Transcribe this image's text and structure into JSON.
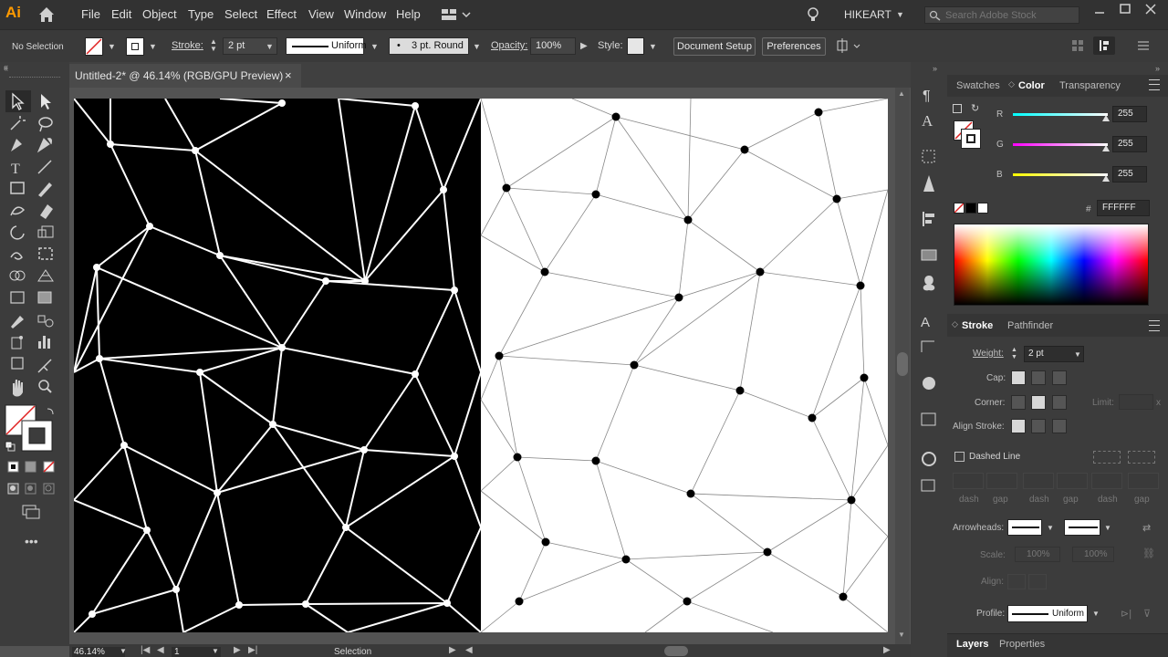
{
  "app": {
    "logo": "Ai"
  },
  "menu": {
    "items": [
      "File",
      "Edit",
      "Object",
      "Type",
      "Select",
      "Effect",
      "View",
      "Window",
      "Help"
    ],
    "user": "HIKEART",
    "search_placeholder": "Search Adobe Stock"
  },
  "control_bar": {
    "selection": "No Selection",
    "stroke_label": "Stroke:",
    "stroke_value": "2 pt",
    "profile": "Uniform",
    "brush": "3 pt. Round",
    "opacity_label": "Opacity:",
    "opacity_value": "100%",
    "style_label": "Style:",
    "document_setup": "Document Setup",
    "preferences": "Preferences"
  },
  "document": {
    "tab_title": "Untitled-2* @ 46.14% (RGB/GPU Preview)",
    "close": "×"
  },
  "status": {
    "zoom": "46.14%",
    "page": "1",
    "mode": "Selection"
  },
  "color_panel": {
    "tabs": [
      "Swatches",
      "Color",
      "Transparency"
    ],
    "active_tab": "Color",
    "channels": [
      {
        "name": "R",
        "value": "255",
        "color": "#25e0e6"
      },
      {
        "name": "G",
        "value": "255",
        "color": "#e64ad6"
      },
      {
        "name": "B",
        "value": "255",
        "color": "#e6e020"
      }
    ],
    "hex_label": "#",
    "hex_value": "FFFFFF"
  },
  "stroke_panel": {
    "tabs": [
      "Stroke",
      "Pathfinder"
    ],
    "active_tab": "Stroke",
    "weight_label": "Weight:",
    "weight_value": "2 pt",
    "cap_label": "Cap:",
    "corner_label": "Corner:",
    "limit_label": "Limit:",
    "limit_mult": "x",
    "align_label": "Align Stroke:",
    "dashed_label": "Dashed Line",
    "dash_labels": [
      "dash",
      "gap",
      "dash",
      "gap",
      "dash",
      "gap"
    ],
    "arrowheads_label": "Arrowheads:",
    "scale_label": "Scale:",
    "scale_values": [
      "100%",
      "100%"
    ],
    "align2_label": "Align:",
    "profile_label": "Profile:",
    "profile_value": "Uniform"
  },
  "bottom_tabs": [
    "Layers",
    "Properties"
  ],
  "artwork": {
    "left_bg": "#000000",
    "left_stroke": "#ffffff",
    "right_bg": "#ffffff",
    "right_stroke": "#888888",
    "dot_color": "#000000"
  }
}
